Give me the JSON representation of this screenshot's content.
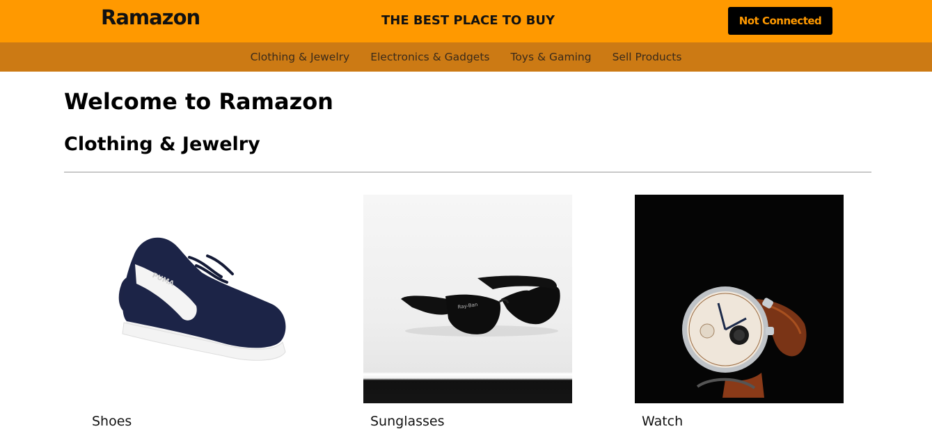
{
  "header": {
    "logo": "Ramazon",
    "tagline": "THE BEST PLACE TO BUY",
    "connect_button": "Not Connected"
  },
  "nav": {
    "items": [
      {
        "label": "Clothing & Jewelry"
      },
      {
        "label": "Electronics & Gadgets"
      },
      {
        "label": "Toys & Gaming"
      },
      {
        "label": "Sell Products"
      }
    ]
  },
  "main": {
    "welcome": "Welcome to Ramazon",
    "section_title": "Clothing & Jewelry",
    "products": [
      {
        "name": "Shoes",
        "icon": "sneaker-image"
      },
      {
        "name": "Sunglasses",
        "icon": "sunglasses-image"
      },
      {
        "name": "Watch",
        "icon": "watch-image"
      }
    ]
  },
  "colors": {
    "topbar": "#ff9900",
    "navbar": "#cc7a14",
    "button_bg": "#000000",
    "button_text": "#ff9900"
  }
}
